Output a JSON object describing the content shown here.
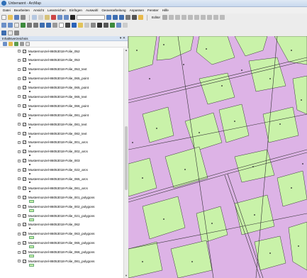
{
  "window": {
    "title": "Unbenannt - ArcMap"
  },
  "menu": [
    "Datei",
    "Bearbeiten",
    "Ansicht",
    "Lesezeichen",
    "Einfügen",
    "Auswahl",
    "Geoverarbeitung",
    "Anpassen",
    "Fenster",
    "Hilfe"
  ],
  "toolbar": {
    "editor_label": "Editor"
  },
  "toc": {
    "title": "Inhaltsverzeichnis"
  },
  "layers": [
    {
      "name": "Mustermonzel-86053018-Folie_052",
      "symbol": "point"
    },
    {
      "name": "Mustermonzel-86053018-Folie_053",
      "symbol": "point"
    },
    {
      "name": "Mustermonzel-86053018-Folie_053_text",
      "symbol": "point"
    },
    {
      "name": "Mustermonzel-86053018-Folie_065_point",
      "symbol": "point"
    },
    {
      "name": "Mustermonzel-86053018-Folie_065_point",
      "symbol": "point"
    },
    {
      "name": "Mustermonzel-86053018-Folie_065_text",
      "symbol": "point"
    },
    {
      "name": "Mustermonzel-86053018-Folie_066_point",
      "symbol": "point"
    },
    {
      "name": "Mustermonzel-86053018-Folie_081_point",
      "symbol": "point"
    },
    {
      "name": "Mustermonzel-86053018-Folie_081_text",
      "symbol": "point"
    },
    {
      "name": "Mustermonzel-86053018-Folie_082_text",
      "symbol": "point"
    },
    {
      "name": "Mustermonzel-86053018-Folie_001_arcs",
      "symbol": "point"
    },
    {
      "name": "Mustermonzel-86053018-Folie_002_arcs",
      "symbol": "point"
    },
    {
      "name": "Mustermonzel-86053018-Folie_003",
      "symbol": "point"
    },
    {
      "name": "Mustermonzel-86053018-Folie_022_arcs",
      "symbol": "point"
    },
    {
      "name": "Mustermonzel-86053018-Folie_065_arcs",
      "symbol": "point"
    },
    {
      "name": "Mustermonzel-86053018-Folie_081_arcs",
      "symbol": "point"
    },
    {
      "name": "Mustermonzel-86053018-Folie_001_polygons",
      "symbol": "polygon"
    },
    {
      "name": "Mustermonzel-86053018-Folie_002_polygons",
      "symbol": "polygon"
    },
    {
      "name": "Mustermonzel-86053018-Folie_021_polygons",
      "symbol": "polygon"
    },
    {
      "name": "Mustermonzel-86053018-Folie_062",
      "symbol": "point"
    },
    {
      "name": "Mustermonzel-86053018-Folie_063_polygons",
      "symbol": "polygon"
    },
    {
      "name": "Mustermonzel-86053018-Folie_065_polygons",
      "symbol": "polygon"
    },
    {
      "name": "Mustermonzel-86053018-Folie_066_polygons",
      "symbol": "polygon"
    },
    {
      "name": "Mustermonzel-86053018-Folie_081_polygons",
      "symbol": "polygon"
    }
  ],
  "map": {
    "background": "#ddb3e6",
    "parcel_fill": "#c9f2a9"
  }
}
